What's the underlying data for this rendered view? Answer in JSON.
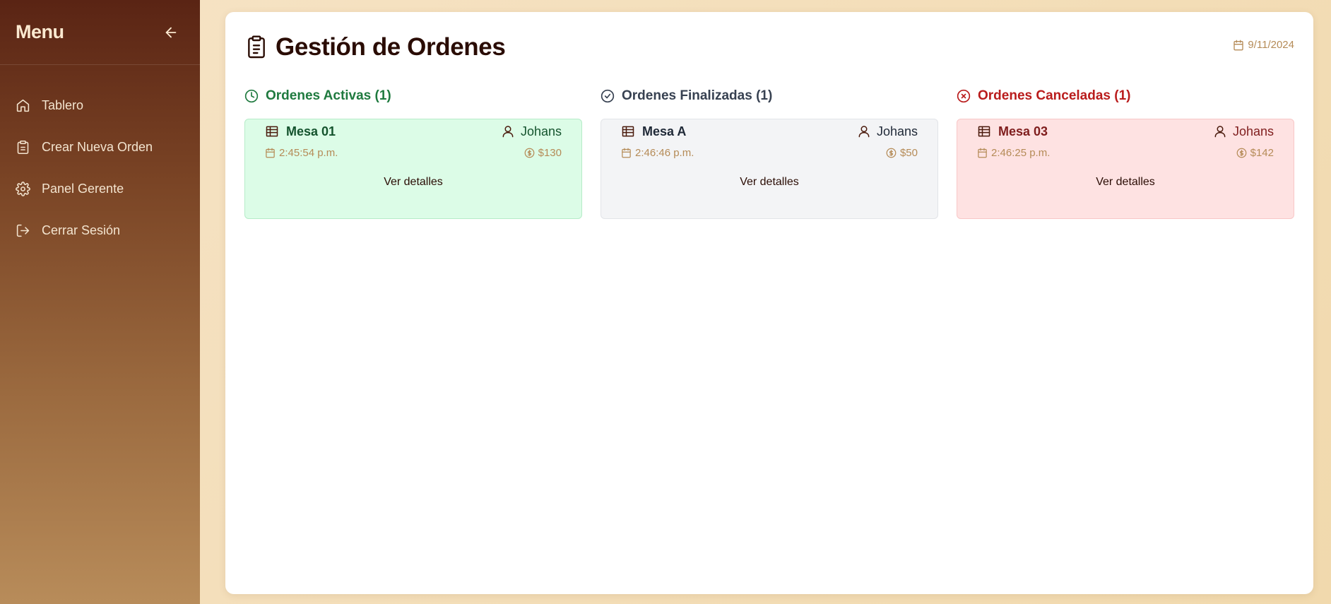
{
  "sidebar": {
    "title": "Menu",
    "items": [
      {
        "label": "Tablero",
        "icon": "home-icon"
      },
      {
        "label": "Crear Nueva Orden",
        "icon": "clipboard-icon"
      },
      {
        "label": "Panel Gerente",
        "icon": "gear-icon"
      },
      {
        "label": "Cerrar Sesión",
        "icon": "logout-icon"
      }
    ]
  },
  "page": {
    "title": "Gestión de Ordenes",
    "date": "9/11/2024"
  },
  "columns": [
    {
      "title": "Ordenes Activas (1)",
      "status": "active",
      "color": "#1f7a3f",
      "icon": "clock-icon",
      "orders": [
        {
          "table": "Mesa 01",
          "waiter": "Johans",
          "time": "2:45:54 p.m.",
          "total": "$130",
          "action": "Ver detalles"
        }
      ]
    },
    {
      "title": "Ordenes Finalizadas (1)",
      "status": "finished",
      "color": "#374151",
      "icon": "check-circle-icon",
      "orders": [
        {
          "table": "Mesa A",
          "waiter": "Johans",
          "time": "2:46:46 p.m.",
          "total": "$50",
          "action": "Ver detalles"
        }
      ]
    },
    {
      "title": "Ordenes Canceladas (1)",
      "status": "cancelled",
      "color": "#b91c1c",
      "icon": "x-circle-icon",
      "orders": [
        {
          "table": "Mesa 03",
          "waiter": "Johans",
          "time": "2:46:25 p.m.",
          "total": "$142",
          "action": "Ver detalles"
        }
      ]
    }
  ]
}
